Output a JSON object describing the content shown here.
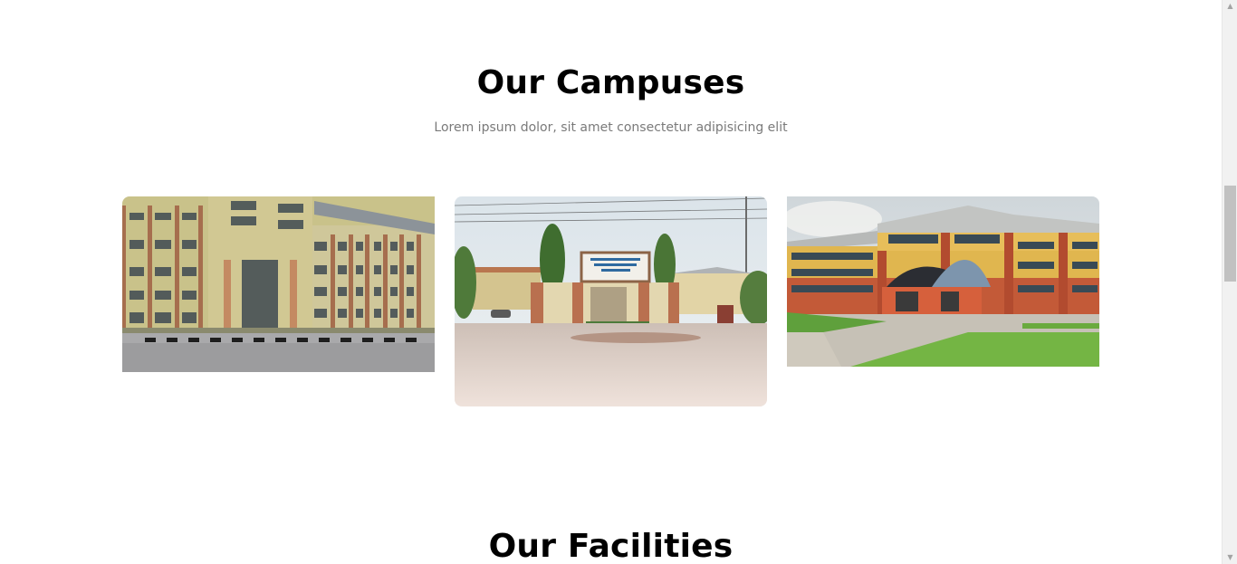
{
  "campuses": {
    "title": "Our Campuses",
    "subtitle": "Lorem ipsum dolor, sit amet consectetur adipisicing elit"
  },
  "facilities": {
    "title": "Our Facilities"
  },
  "gallery_icons": [
    "building-photo",
    "gate-photo",
    "faculty-photo"
  ],
  "scrollbar": {
    "up_glyph": "▲",
    "down_glyph": "▼"
  }
}
